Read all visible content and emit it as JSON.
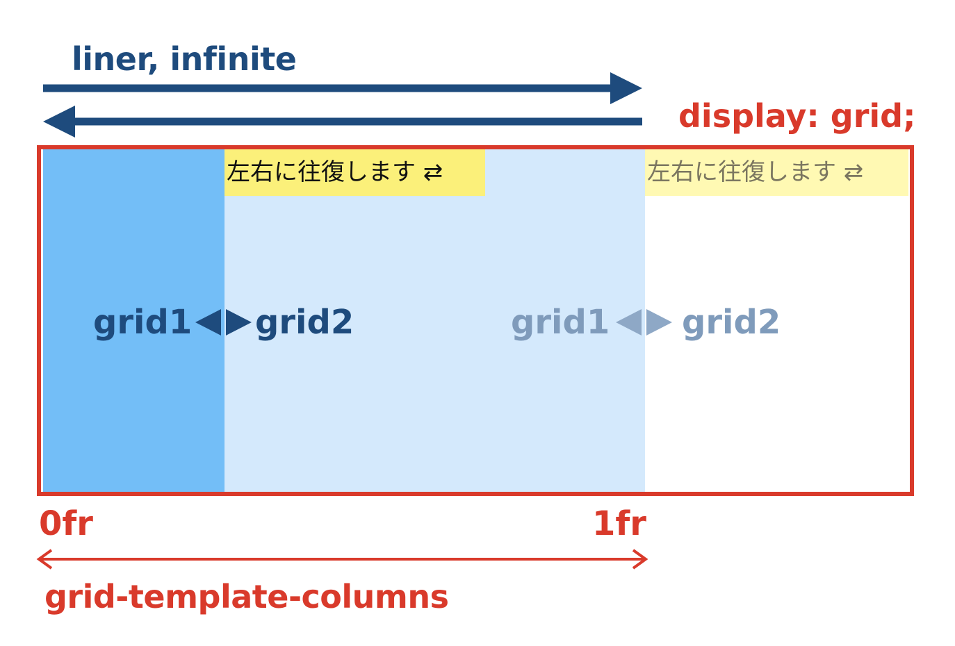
{
  "direction_label": "liner, infinite",
  "container_label": "display: grid;",
  "columns": {
    "grid1_label": "grid1",
    "grid2_label": "grid2",
    "ghost_grid1_label": "grid1",
    "ghost_grid2_label": "grid2"
  },
  "bounce_note": {
    "active_text": "左右に往復します ⇄",
    "ghost_text": "左右に往復します ⇄"
  },
  "axis": {
    "start_label": "0fr",
    "end_label": "1fr",
    "property_label": "grid-template-columns"
  },
  "colors": {
    "navy": "#1e4b7d",
    "red": "#d93a2b",
    "grid1_fill": "#73bef7",
    "grid2_fill": "#d4e9fc",
    "note_fill": "#fbf07a",
    "ghost_text": "#7f9bbb"
  }
}
